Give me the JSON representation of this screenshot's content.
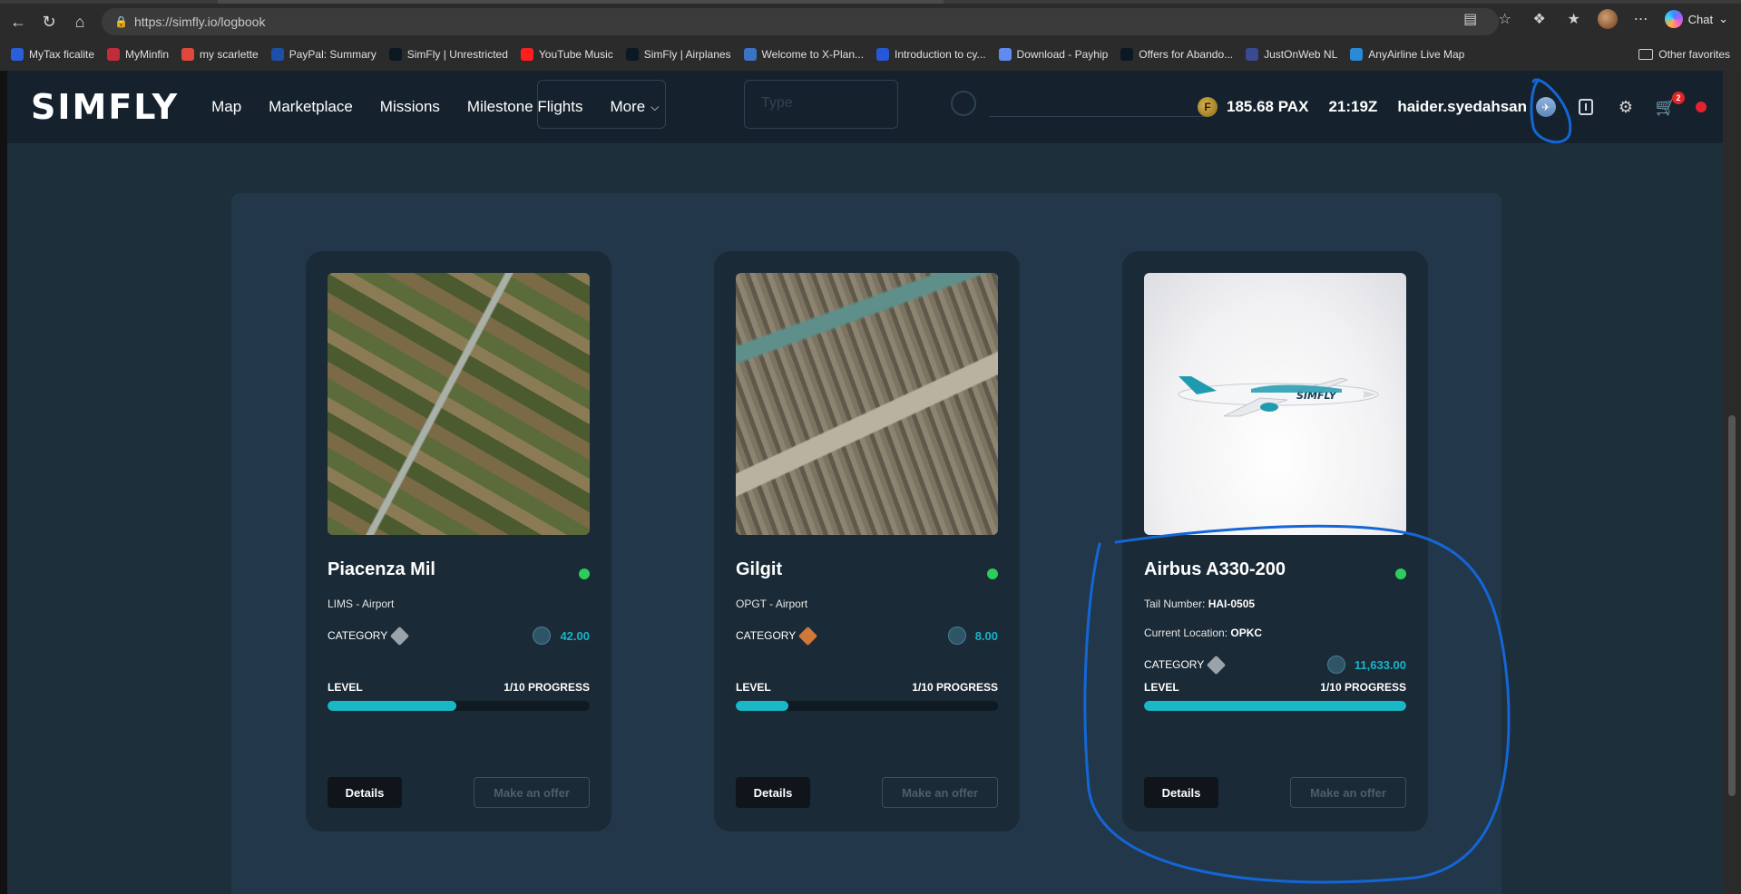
{
  "browser": {
    "url": "https://simfly.io/logbook",
    "chat_label": "Chat",
    "bookmarks": [
      {
        "label": "MyTax ficalite",
        "color": "#2b5fd9"
      },
      {
        "label": "MyMinfin",
        "color": "#c02c3a"
      },
      {
        "label": "my scarlette",
        "color": "#e0483e"
      },
      {
        "label": "PayPal: Summary",
        "color": "#1d4fa8"
      },
      {
        "label": "SimFly | Unrestricted",
        "color": "#0c1822"
      },
      {
        "label": "YouTube Music",
        "color": "#ff1f1f"
      },
      {
        "label": "SimFly | Airplanes",
        "color": "#0c1822"
      },
      {
        "label": "Welcome to X-Plan...",
        "color": "#3a72c4"
      },
      {
        "label": "Introduction to cy...",
        "color": "#2558d6"
      },
      {
        "label": "Download - Payhip",
        "color": "#5f8cf0"
      },
      {
        "label": "Offers for Abando...",
        "color": "#0c1822"
      },
      {
        "label": "JustOnWeb NL",
        "color": "#3a4a90"
      },
      {
        "label": "AnyAirline Live Map",
        "color": "#2a8ad8"
      }
    ],
    "other_favorites": "Other favorites"
  },
  "app": {
    "logo": "SIMFLY",
    "nav": [
      "Map",
      "Marketplace",
      "Missions",
      "Milestone Flights",
      "More"
    ],
    "filter_type_placeholder": "Type",
    "pax_balance": "185.68 PAX",
    "time": "21:19Z",
    "username": "haider.syedahsan",
    "cart_count": "2"
  },
  "cards": [
    {
      "title": "Piacenza Mil",
      "line1_code": "LIMS",
      "line1_sep": " -  ",
      "line1_text": "Airport",
      "category_label": "CATEGORY",
      "category_color": "#9aa3aa",
      "value": "42.00",
      "level_label": "LEVEL",
      "progress_label": "1/10 PROGRESS",
      "progress": 0.49,
      "details_label": "Details",
      "offer_label": "Make an offer"
    },
    {
      "title": "Gilgit",
      "line1_code": "OPGT",
      "line1_sep": " -  ",
      "line1_text": "Airport",
      "category_label": "CATEGORY",
      "category_color": "#d0773a",
      "value": "8.00",
      "level_label": "LEVEL",
      "progress_label": "1/10 PROGRESS",
      "progress": 0.2,
      "details_label": "Details",
      "offer_label": "Make an offer"
    },
    {
      "title": "Airbus A330-200",
      "tail_label": "Tail Number:",
      "tail_value": "HAI-0505",
      "loc_label": "Current Location:",
      "loc_value": "OPKC",
      "category_label": "CATEGORY",
      "category_color": "#9aa3aa",
      "value": "11,633.00",
      "level_label": "LEVEL",
      "progress_label": "1/10 PROGRESS",
      "progress": 1.0,
      "details_label": "Details",
      "offer_label": "Make an offer"
    }
  ],
  "colors": {
    "accent": "#1ab7c7",
    "annotation": "#1466d6",
    "online": "#2ecc5a"
  }
}
